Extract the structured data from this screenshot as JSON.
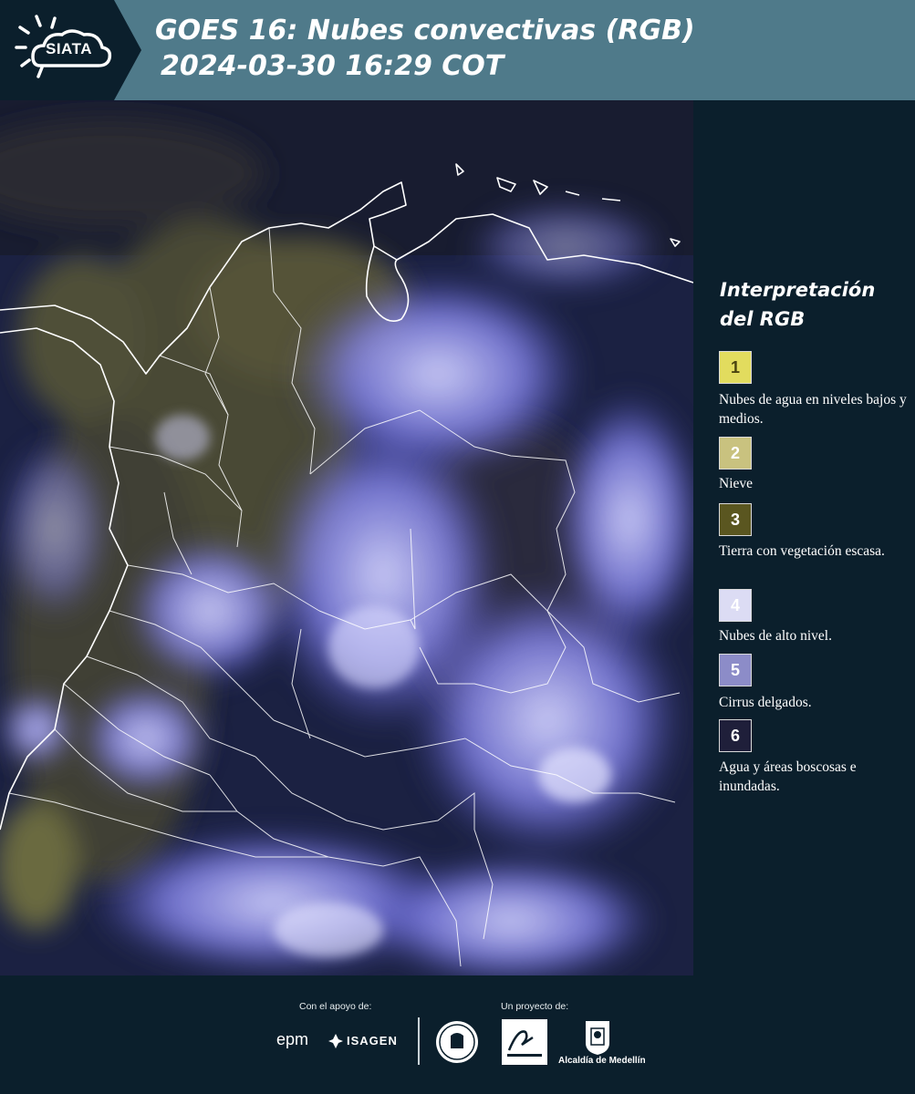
{
  "header": {
    "logo_text": "SIATA",
    "title_line1": "GOES 16: Nubes convectivas (RGB)",
    "title_line2": "2024-03-30 16:29 COT",
    "background_color": "#4f7a8a"
  },
  "map": {
    "icon": "satellite-composite-image",
    "ocean_color": "#1b2142",
    "land_color": "#4b4a34",
    "cloud_color": "#8c8cf0",
    "border_color": "#ffffff"
  },
  "legend": {
    "title": "Interpretación del RGB",
    "items": [
      {
        "number": "1",
        "label": "Nubes de agua en niveles bajos y medios.",
        "color": "#e2dc5e",
        "text_color": "#4a4410"
      },
      {
        "number": "2",
        "label": "Nieve",
        "color": "#c9c27f",
        "text_color": "#ffffff"
      },
      {
        "number": "3",
        "label": "Tierra con vegetación escasa.",
        "color": "#5a5620",
        "text_color": "#ffffff"
      },
      {
        "number": "4",
        "label": "Nubes de alto nivel.",
        "color": "#dcdcf4",
        "text_color": "#ffffff"
      },
      {
        "number": "5",
        "label": "Cirrus delgados.",
        "color": "#8c8cc8",
        "text_color": "#ffffff"
      },
      {
        "number": "6",
        "label": "Agua y áreas boscosas e inundadas.",
        "color": "#1f1f3a",
        "text_color": "#ffffff"
      }
    ]
  },
  "footer": {
    "support_caption": "Con el apoyo de:",
    "project_caption": "Un proyecto de:",
    "epm": "epm",
    "isagen": "ISAGEN",
    "alcaldia": "Alcaldía de Medellín",
    "icons": [
      "epm-logo",
      "isagen-logo",
      "univ-seal-icon",
      "area-metropolitana-logo",
      "alcaldia-shield-icon"
    ]
  }
}
